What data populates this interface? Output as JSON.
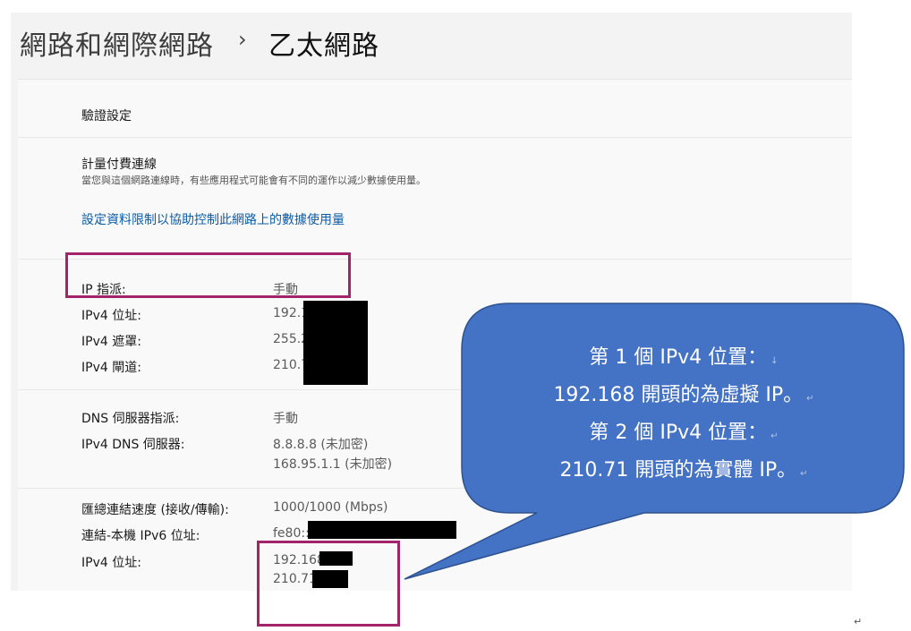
{
  "breadcrumb": {
    "parent": "網路和網際網路",
    "separator": "›",
    "current": "乙太網路"
  },
  "auth": {
    "label": "驗證設定"
  },
  "metered": {
    "title": "計量付費連線",
    "description": "當您與這個網路連線時，有些應用程式可能會有不同的運作以減少數據使用量。",
    "link": "設定資料限制以協助控制此網路上的數據使用量"
  },
  "ip": {
    "assignment_label": "IP 指派:",
    "assignment_value": "手動",
    "ipv4_address_label": "IPv4 位址:",
    "ipv4_address_value": "192.1",
    "ipv4_mask_label": "IPv4 遮罩:",
    "ipv4_mask_value": "255.2",
    "ipv4_gateway_label": "IPv4 閘道:",
    "ipv4_gateway_value": "210.7"
  },
  "dns": {
    "assignment_label": "DNS 伺服器指派:",
    "assignment_value": "手動",
    "servers_label": "IPv4 DNS 伺服器:",
    "server_1": "8.8.8.8 (未加密)",
    "server_2": "168.95.1.1 (未加密)"
  },
  "link_info": {
    "speed_label": "匯總連結速度 (接收/傳輸):",
    "speed_value": "1000/1000 (Mbps)",
    "ipv6_label": "連結-本機 IPv6 位址:",
    "ipv6_value": "fe80::",
    "ipv4_label": "IPv4 位址:",
    "ipv4_value_1": "192.168",
    "ipv4_value_2": "210.71"
  },
  "callout": {
    "line1": "第 1 個 IPv4 位置：",
    "line2": "192.168 開頭的為虛擬 IP。",
    "line3": "第 2 個 IPv4 位置：",
    "line4": "210.71 開頭的為實體 IP。",
    "fill_color": "#4472c4",
    "stroke_color": "#2f528f",
    "mark": "↓",
    "para_mark": "↵"
  },
  "colors": {
    "highlight": "#a4246b",
    "link": "#0b5ca8",
    "redaction": "#000000"
  }
}
